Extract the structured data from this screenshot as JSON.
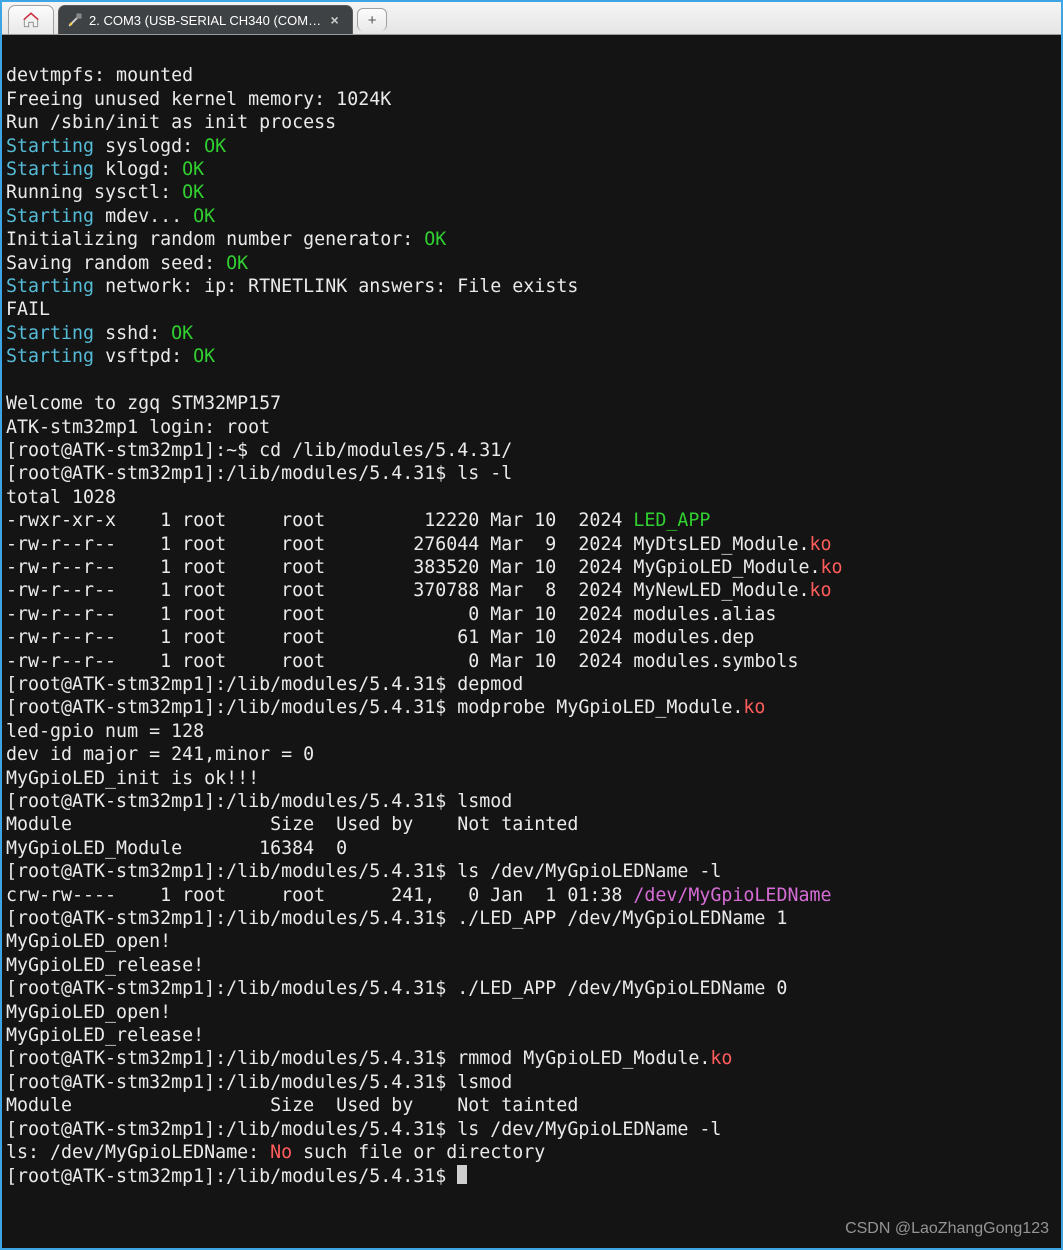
{
  "tabs": {
    "active_label": "2. COM3  (USB-SERIAL CH340 (COM…",
    "close_glyph": "×",
    "add_glyph": "+"
  },
  "watermark": "CSDN @LaoZhangGong123",
  "colors": {
    "green": "#30d030",
    "cyan": "#55bcd8",
    "red": "#ff5c5c",
    "magenta": "#d66cd6",
    "bg": "#141414",
    "fg": "#eaeaea"
  },
  "term": {
    "l00": "devtmpfs: mounted",
    "l01": "Freeing unused kernel memory: 1024K",
    "l02": "Run /sbin/init as init process",
    "l03a": "Starting",
    "l03b": " syslogd: ",
    "l03c": "OK",
    "l04a": "Starting",
    "l04b": " klogd: ",
    "l04c": "OK",
    "l05a": "Running sysctl: ",
    "l05b": "OK",
    "l06a": "Starting",
    "l06b": " mdev... ",
    "l06c": "OK",
    "l07a": "Initializing random number generator: ",
    "l07b": "OK",
    "l08a": "Saving random seed: ",
    "l08b": "OK",
    "l09a": "Starting",
    "l09b": " network: ip: RTNETLINK answers: File exists",
    "l10": "FAIL",
    "l11a": "Starting",
    "l11b": " sshd: ",
    "l11c": "OK",
    "l12a": "Starting",
    "l12b": " vsftpd: ",
    "l12c": "OK",
    "blank": "",
    "l14": "Welcome to zgq STM32MP157",
    "l15": "ATK-stm32mp1 login: root",
    "l16": "[root@ATK-stm32mp1]:~$ cd /lib/modules/5.4.31/",
    "l17": "[root@ATK-stm32mp1]:/lib/modules/5.4.31$ ls -l",
    "l18": "total 1028",
    "ls0a": "-rwxr-xr-x    1 root     root         12220 Mar 10  2024 ",
    "ls0b": "LED_APP",
    "ls1a": "-rw-r--r--    1 root     root        276044 Mar  9  2024 MyDtsLED_Module.",
    "ls1b": "ko",
    "ls2a": "-rw-r--r--    1 root     root        383520 Mar 10  2024 MyGpioLED_Module.",
    "ls2b": "ko",
    "ls3a": "-rw-r--r--    1 root     root        370788 Mar  8  2024 MyNewLED_Module.",
    "ls3b": "ko",
    "ls4": "-rw-r--r--    1 root     root             0 Mar 10  2024 modules.alias",
    "ls5": "-rw-r--r--    1 root     root            61 Mar 10  2024 modules.dep",
    "ls6": "-rw-r--r--    1 root     root             0 Mar 10  2024 modules.symbols",
    "l26": "[root@ATK-stm32mp1]:/lib/modules/5.4.31$ depmod",
    "l27a": "[root@ATK-stm32mp1]:/lib/modules/5.4.31$ modprobe MyGpioLED_Module.",
    "l27b": "ko",
    "l28": "led-gpio num = 128",
    "l29": "dev id major = 241,minor = 0",
    "l30": "MyGpioLED_init is ok!!!",
    "l31": "[root@ATK-stm32mp1]:/lib/modules/5.4.31$ lsmod",
    "l32": "Module                  Size  Used by    Not tainted",
    "l33": "MyGpioLED_Module       16384  0",
    "l34": "[root@ATK-stm32mp1]:/lib/modules/5.4.31$ ls /dev/MyGpioLEDName -l",
    "l35a": "crw-rw----    1 root     root      241,   0 Jan  1 01:38 ",
    "l35b": "/dev/MyGpioLEDName",
    "l36": "[root@ATK-stm32mp1]:/lib/modules/5.4.31$ ./LED_APP /dev/MyGpioLEDName 1",
    "l37": "MyGpioLED_open!",
    "l38": "MyGpioLED_release!",
    "l39": "[root@ATK-stm32mp1]:/lib/modules/5.4.31$ ./LED_APP /dev/MyGpioLEDName 0",
    "l40": "MyGpioLED_open!",
    "l41": "MyGpioLED_release!",
    "l42a": "[root@ATK-stm32mp1]:/lib/modules/5.4.31$ rmmod MyGpioLED_Module.",
    "l42b": "ko",
    "l43": "[root@ATK-stm32mp1]:/lib/modules/5.4.31$ lsmod",
    "l44": "Module                  Size  Used by    Not tainted",
    "l45": "[root@ATK-stm32mp1]:/lib/modules/5.4.31$ ls /dev/MyGpioLEDName -l",
    "l46a": "ls: /dev/MyGpioLEDName: ",
    "l46b": "No",
    "l46c": " such file or directory",
    "l47": "[root@ATK-stm32mp1]:/lib/modules/5.4.31$ "
  }
}
